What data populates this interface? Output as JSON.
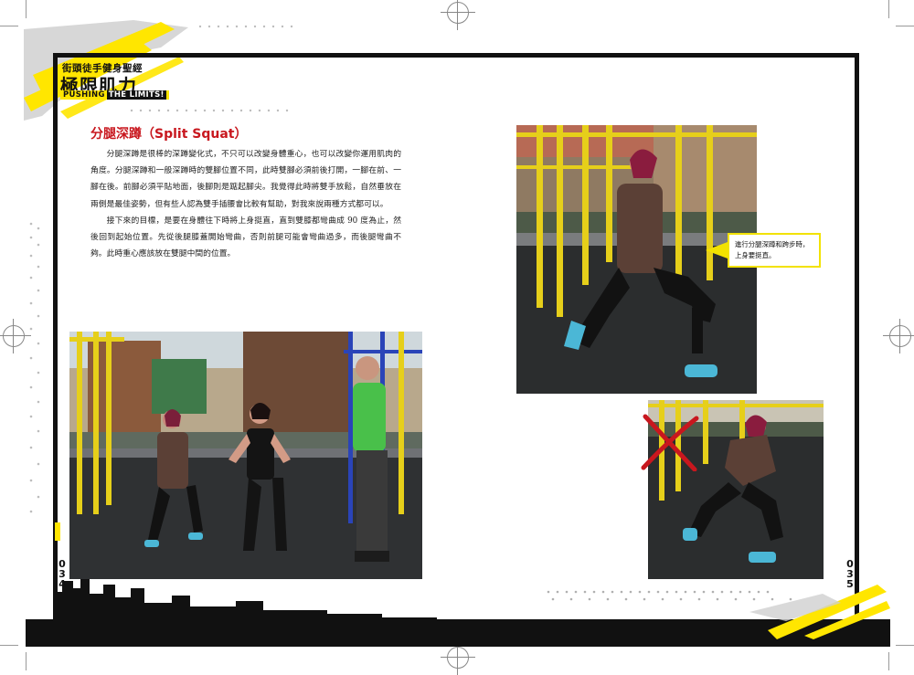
{
  "header": {
    "series_title": "街頭徒手健身聖經",
    "book_title": "極限肌力",
    "subtitle_a": "PUSHING",
    "subtitle_b": "THE LIMITS!"
  },
  "section": {
    "title": "分腿深蹲（Split Squat）",
    "paragraphs": [
      "分腿深蹲是很棒的深蹲變化式，不只可以改變身體重心，也可以改變你運用肌肉的角度。分腿深蹲和一般深蹲時的雙腳位置不同，此時雙腳必須前後打開，一腳在前、一腳在後。前腳必須平貼地面，後腳則是踮起腳尖。我覺得此時將雙手放鬆，自然垂放在兩側是最佳姿勢，但有些人認為雙手插腰會比較有幫助，對我來說兩種方式都可以。",
      "接下來的目標，是要在身體往下時將上身挺直，直到雙膝都彎曲成 90 度為止，然後回到起始位置。先從後腿膝蓋開始彎曲，否則前腿可能會彎曲過多，而後腿彎曲不夠。此時重心應該放在雙腿中間的位置。"
    ]
  },
  "callout": {
    "line1": "進行分腿深蹲和跨步時，",
    "line2": "上身要挺直。"
  },
  "page_numbers": {
    "left": [
      "0",
      "3",
      "4"
    ],
    "right": [
      "0",
      "3",
      "5"
    ]
  },
  "colors": {
    "accent_red": "#c8171e",
    "accent_yellow": "#ffe600",
    "frame": "#111111"
  }
}
